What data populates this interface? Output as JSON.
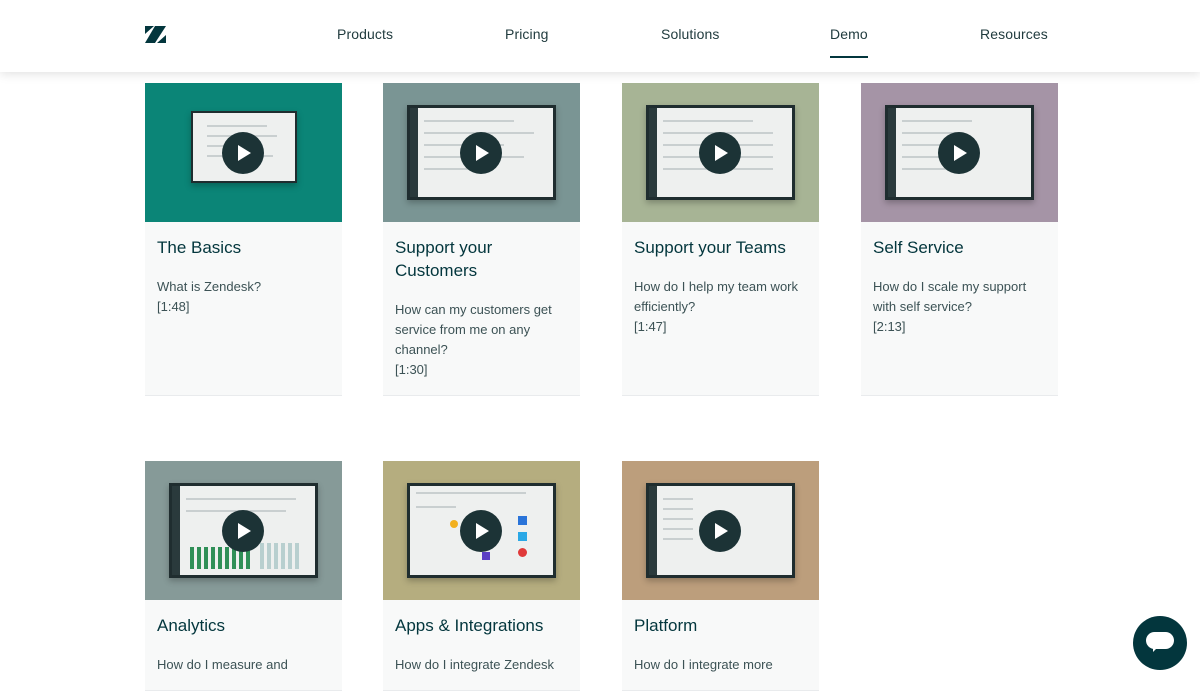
{
  "nav": {
    "logo_icon": "zendesk-logo-icon",
    "items": [
      {
        "label": "Products"
      },
      {
        "label": "Pricing"
      },
      {
        "label": "Solutions"
      },
      {
        "label": "Demo",
        "active": true
      },
      {
        "label": "Resources"
      }
    ]
  },
  "cards": [
    {
      "title": "The Basics",
      "description": "What is Zendesk?",
      "duration": "[1:48]",
      "thumb_color": "#0b8577"
    },
    {
      "title": "Support your Customers",
      "description": "How can my customers get service from me on any channel?",
      "duration": "[1:30]",
      "thumb_color": "#7a9594"
    },
    {
      "title": "Support your Teams",
      "description": "How do I help my team work efficiently?",
      "duration": "[1:47]",
      "thumb_color": "#a7b495"
    },
    {
      "title": "Self Service",
      "description": "How do I scale my support with self service?",
      "duration": "[2:13]",
      "thumb_color": "#a594a6"
    },
    {
      "title": "Analytics",
      "description": "How do I measure and",
      "duration": "",
      "thumb_color": "#869a98"
    },
    {
      "title": "Apps & Integrations",
      "description": "How do I integrate Zendesk",
      "duration": "",
      "thumb_color": "#b5ad7f"
    },
    {
      "title": "Platform",
      "description": "How do I integrate more",
      "duration": "",
      "thumb_color": "#bc9e7c"
    }
  ],
  "chat": {
    "icon": "chat-bubble-icon"
  }
}
